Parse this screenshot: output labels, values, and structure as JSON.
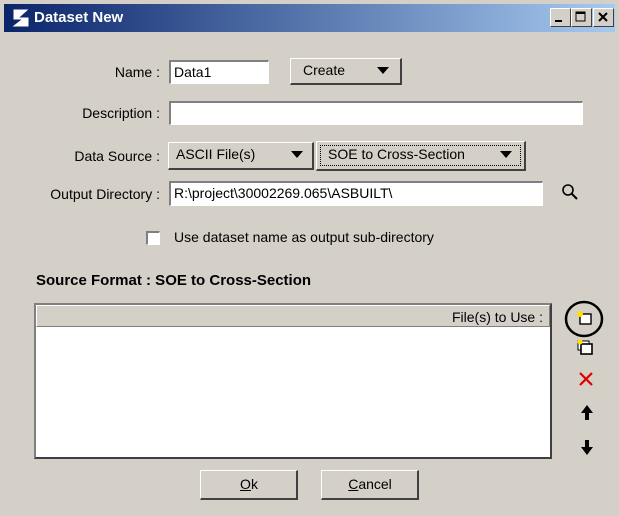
{
  "window": {
    "title": "Dataset New",
    "controls": {
      "minimize": "minimize-icon",
      "maximize": "maximize-icon",
      "close": "close-icon"
    }
  },
  "form": {
    "name_label": "Name :",
    "name_value": "Data1",
    "create_label": "Create",
    "description_label": "Description :",
    "description_value": "",
    "data_source_label": "Data Source :",
    "data_source_type": "ASCII File(s)",
    "data_source_format": "SOE to Cross-Section",
    "output_dir_label": "Output Directory :",
    "output_dir_value": "R:\\project\\30002269.065\\ASBUILT\\",
    "use_subdir_label": "Use dataset name as output sub-directory",
    "use_subdir_checked": false
  },
  "source_format": {
    "heading": "Source Format : SOE to Cross-Section",
    "column_header": "File(s) to Use :",
    "files": []
  },
  "side_tools": [
    "add-file-icon",
    "copy-file-icon",
    "delete-icon",
    "move-up-icon",
    "move-down-icon"
  ],
  "buttons": {
    "ok_label": "Ok",
    "ok_mnemonic": "O",
    "cancel_label": "Cancel",
    "cancel_mnemonic": "C"
  },
  "colors": {
    "title_start": "#0a246a",
    "title_end": "#a6caf0",
    "dialog_bg": "#d4d0c8",
    "delete_red": "#e00000"
  }
}
